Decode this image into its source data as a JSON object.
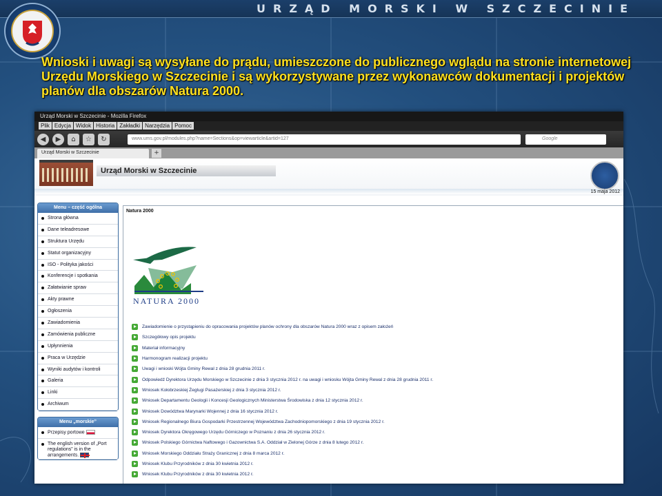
{
  "slide": {
    "header_text": "URZĄD MORSKI W SZCZECINIE",
    "headline": "Wnioski i uwagi są wysyłane do prądu, umieszczone do publicznego wglądu na stronie internetowej Urzędu Morskiego w Szczecinie i są wykorzystywane przez wykonawców dokumentacji i projektów planów dla obszarów Natura 2000."
  },
  "browser": {
    "window_title": "Urząd Morski w Szczecinie - Mozilla Firefox",
    "menu": [
      "Plik",
      "Edycja",
      "Widok",
      "Historia",
      "Zakładki",
      "Narzędzia",
      "Pomoc"
    ],
    "url": "www.ums.gov.pl/modules.php?name=Sections&op=viewarticle&artid=127",
    "search_placeholder": "Google",
    "tab_label": "Urząd Morski w Szczecinie",
    "new_tab": "+"
  },
  "site": {
    "title": "Urząd Morski w Szczecinie",
    "date": "15 maja 2012"
  },
  "left_menu": {
    "general_title": "Menu – część ogólna",
    "general_items": [
      "Strona główna",
      "Dane teleadresowe",
      "Struktura Urzędu",
      "Statut organizacyjny",
      "ISO - Polityka jakości",
      "Konferencje i spotkania",
      "Załatwianie spraw",
      "Akty prawne",
      "Ogłoszenia",
      "Zawiadomienia",
      "Zamówienia publiczne",
      "Upłynnienia",
      "Praca w Urzędzie",
      "Wyniki audytów i kontroli",
      "Galeria",
      "Linki",
      "Archiwum"
    ],
    "marine_title": "Menu „morskie”",
    "marine_items": [
      "Przepisy portowe",
      "The english version of „Port regulations” is in the arrangements."
    ]
  },
  "main": {
    "title": "Natura 2000",
    "logo_text": "NATURA 2000",
    "links": [
      "Zawiadomienie o przystąpieniu do opracowania projektów planów ochrony dla obszarów Natura 2000 wraz z opisem założeń",
      "Szczegółowy opis projektu",
      "Materiał informacyjny",
      "Harmonogram realizacji projektu",
      "Uwagi i wnioski Wójta Gminy Rewal z dnia 28 grudnia 2011 r.",
      "Odpowiedź Dyrektora Urzędu Morskiego w Szczecinie z dnia 3 stycznia 2012 r. na uwagi i wniosku Wójta Gminy Rewal z dnia 28 grudnia 2011 r.",
      "Wniosek Kołobrzeskiej Żeglugi Pasażerskiej z dnia 3 stycznia 2012 r.",
      "Wniosek Departamentu Geologii i Koncesji Geologicznych Ministerstwa Środowiska z dnia 12 stycznia 2012 r.",
      "Wniosek Dowództwa Marynarki Wojennej z dnia 16 stycznia 2012 r.",
      "Wniosek Regionalnego Biura Gospodarki Przestrzennej Województwa Zachodniopomorskiego z dnia 19 stycznia 2012 r.",
      "Wniosek Dyrektora Okręgowego Urzędu Górniczego w Poznaniu z dnia 26 stycznia 2012 r.",
      "Wniosek Polskiego Górnictwa Naftowego i Gazownictwa S.A. Oddział w Zielonej Górze z dnia 8 lutego 2012 r.",
      "Wniosek Morskiego Oddziału Straży Granicznej z dnia 8 marca 2012 r.",
      "Wniosek Klubu Przyrodników z dnia 30 kwietnia 2012 r.",
      "Wniosek Klubu Przyrodników z dnia 30 kwietnia 2012 r."
    ]
  }
}
